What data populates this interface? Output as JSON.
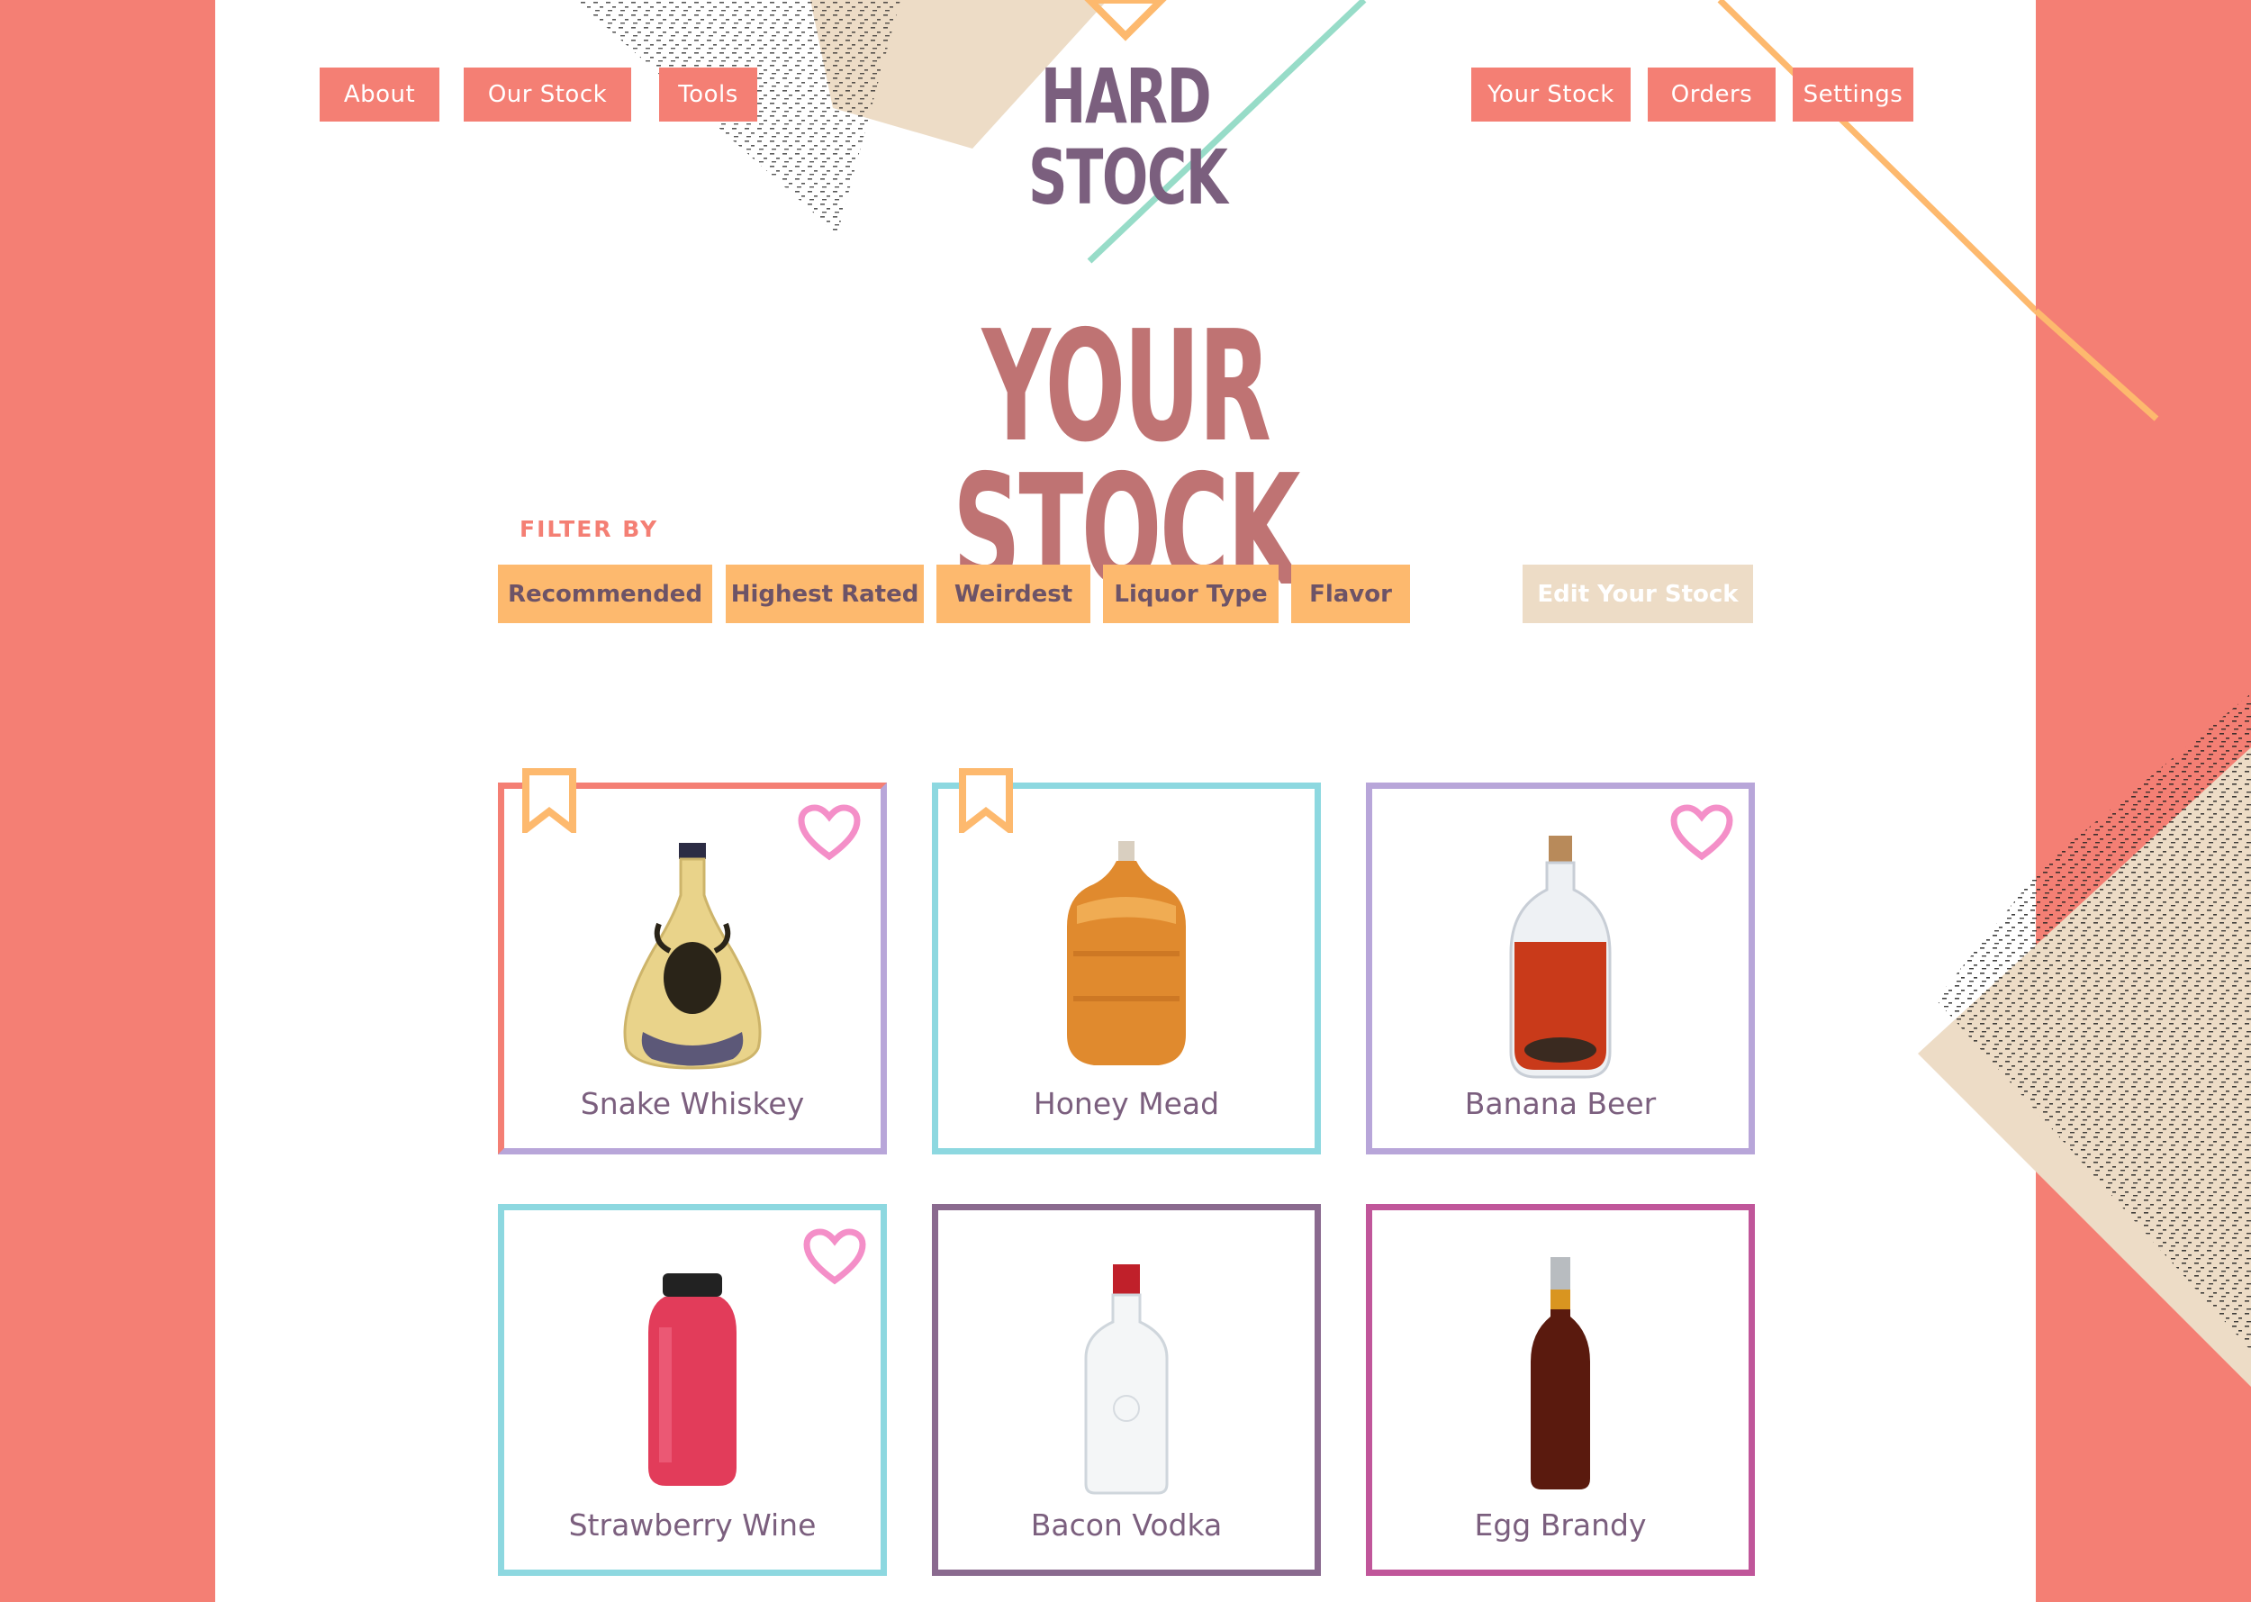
{
  "header": {
    "logo": "HARD STOCK",
    "nav_left": [
      "About",
      "Our Stock",
      "Tools"
    ],
    "nav_right": [
      "Your Stock",
      "Orders",
      "Settings"
    ]
  },
  "main": {
    "title": "YOUR STOCK",
    "filter_label": "FILTER BY",
    "filters": [
      "Recommended",
      "Highest Rated",
      "Weirdest",
      "Liquor Type",
      "Flavor"
    ],
    "edit_label": "Edit Your Stock"
  },
  "products": [
    {
      "name": "Snake Whiskey",
      "favorited": true,
      "bookmarked": true,
      "bottle": "snake-whiskey-bottle-icon"
    },
    {
      "name": "Honey Mead",
      "favorited": false,
      "bookmarked": true,
      "bottle": "mead-jug-icon"
    },
    {
      "name": "Banana Beer",
      "favorited": true,
      "bookmarked": false,
      "bottle": "banana-beer-bottle-icon"
    },
    {
      "name": "Strawberry Wine",
      "favorited": true,
      "bookmarked": false,
      "bottle": "strawberry-wine-bottle-icon"
    },
    {
      "name": "Bacon Vodka",
      "favorited": false,
      "bookmarked": false,
      "bottle": "vodka-bottle-icon"
    },
    {
      "name": "Egg Brandy",
      "favorited": false,
      "bookmarked": false,
      "bottle": "brandy-bottle-icon"
    }
  ],
  "colors": {
    "coral": "#f47f74",
    "orange": "#fdb96e",
    "teal": "#8dd8e0",
    "lavender": "#b8a6d9",
    "plum": "#8a6a8f",
    "magenta": "#c0569a",
    "heart": "#f48fc8",
    "title": "#bf7373",
    "logo": "#7b5f7e"
  }
}
